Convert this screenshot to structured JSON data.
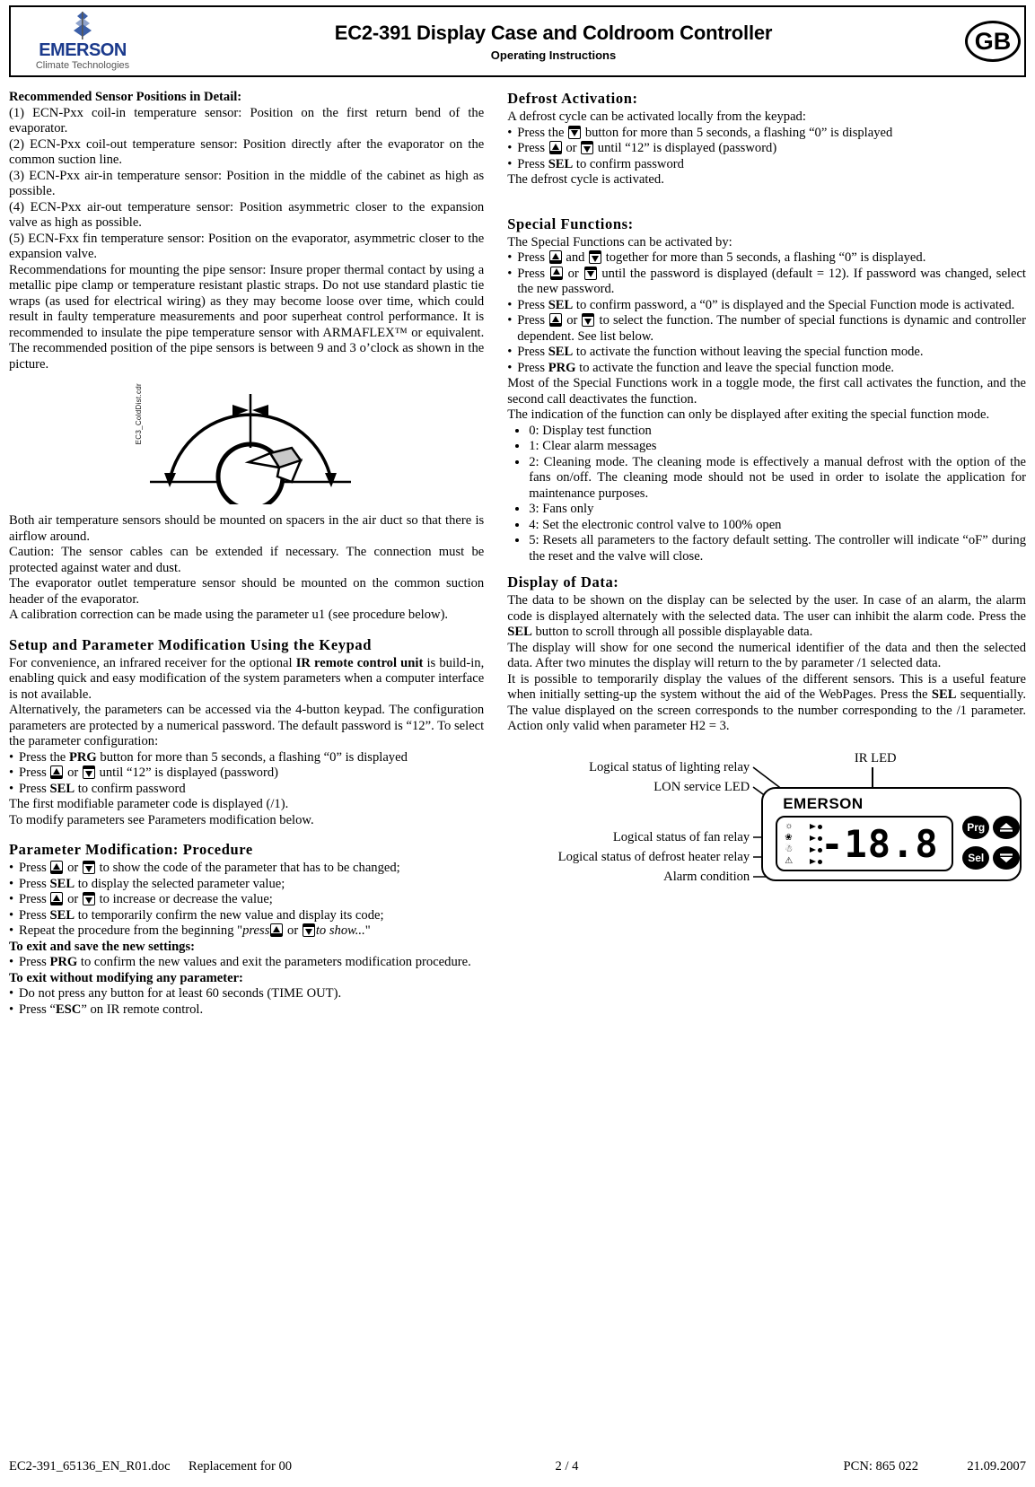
{
  "header": {
    "brand": "EMERSON",
    "brand_sub": "Climate Technologies",
    "title": "EC2-391 Display Case and Coldroom Controller",
    "subtitle": "Operating Instructions",
    "language_badge": "GB"
  },
  "left_column": {
    "sensor_heading": "Recommended Sensor Positions in Detail:",
    "sensor_items": [
      "(1) ECN-Pxx coil-in temperature sensor: Position on the first return bend of the evaporator.",
      " (2) ECN-Pxx coil-out temperature sensor: Position directly after the evaporator on the common suction line.",
      "(3) ECN-Pxx air-in temperature sensor: Position in the middle of the cabinet as high as possible.",
      "(4) ECN-Pxx air-out temperature sensor: Position asymmetric closer to the expansion valve as high as possible.",
      "(5) ECN-Fxx fin temperature sensor: Position on the evaporator, asymmetric closer to the expansion valve."
    ],
    "pipe_recommendation": "Recommendations for mounting the pipe sensor: Insure proper thermal contact by using a metallic pipe clamp or temperature resistant plastic straps. Do not use standard plastic tie wraps (as used for electrical wiring) as they may become loose over time, which could result in faulty temperature measurements and poor superheat control performance. It is recommended to insulate the pipe temperature sensor with ARMAFLEX™ or equivalent. The recommended position of the pipe sensors is between 9 and 3 o’clock as shown in the picture.",
    "figure_label": "EC3_ColdDist.cdr",
    "after_figure": [
      "Both air temperature sensors should be mounted on spacers in the air duct so that there is airflow around.",
      "Caution: The sensor cables can be extended if necessary. The connection must be protected against water and dust.",
      "The evaporator outlet temperature sensor should be mounted on the common suction header of the evaporator.",
      "A calibration correction can be made using the parameter u1 (see procedure below)."
    ],
    "setup_heading": "Setup and Parameter Modification Using the Keypad",
    "setup_p1_a": "For convenience, an infrared receiver for the optional ",
    "setup_p1_b": "IR remote control unit",
    "setup_p1_c": " is build-in, enabling quick and easy modification of the system parameters when a computer interface is not available.",
    "setup_p2": "Alternatively, the parameters can be accessed via the 4-button keypad. The configuration parameters are protected by a numerical password. The default password is “12”. To select the parameter configuration:",
    "setup_b1_a": "Press the ",
    "setup_b1_key": "PRG",
    "setup_b1_b": " button for more than 5 seconds, a flashing “0” is displayed",
    "setup_b2_a": "Press ",
    "setup_b2_mid": " or ",
    "setup_b2_b": " until “12” is displayed (password)",
    "setup_b3_a": "Press ",
    "setup_b3_key": "SEL",
    "setup_b3_b": " to confirm password",
    "setup_p3": "The first modifiable parameter code is displayed (/1).",
    "setup_p4": "To modify parameters see Parameters modification below.",
    "param_heading": "Parameter Modification: Procedure",
    "param_b1_a": "Press ",
    "param_b1_mid": " or ",
    "param_b1_b": " to show the code of the parameter that has to be changed;",
    "param_b2_a": "Press ",
    "param_b2_key": "SEL",
    "param_b2_b": " to display the selected parameter value;",
    "param_b3_a": "Press ",
    "param_b3_mid": " or ",
    "param_b3_b": " to increase or decrease the value;",
    "param_b4_a": "Press ",
    "param_b4_key": "SEL",
    "param_b4_b": " to temporarily confirm the new value and display its code;",
    "param_b5_a": "Repeat the procedure from the beginning \"",
    "param_b5_i1": "press",
    "param_b5_mid": " or ",
    "param_b5_i2": "to show...",
    "param_b5_end": "\"",
    "exit_save_heading": "To exit and save the new settings:",
    "exit_save_a": "Press ",
    "exit_save_key": "PRG",
    "exit_save_b": " to confirm the new values and exit the parameters modification procedure.",
    "exit_nomod_heading": "To exit without modifying any parameter:",
    "exit_nomod_1": "Do not press any button for at least 60 seconds (TIME OUT).",
    "exit_nomod_2_a": "Press “",
    "exit_nomod_2_key": "ESC",
    "exit_nomod_2_b": "” on IR remote control."
  },
  "right_column": {
    "defrost_heading": "Defrost Activation:",
    "defrost_p1": "A defrost cycle can be activated locally from the keypad:",
    "defrost_b1_a": "Press the ",
    "defrost_b1_b": " button for more than 5 seconds, a  flashing “0” is displayed",
    "defrost_b2_a": "Press ",
    "defrost_b2_mid": " or ",
    "defrost_b2_b": " until “12” is displayed (password)",
    "defrost_b3_a": "Press ",
    "defrost_b3_key": "SEL",
    "defrost_b3_b": " to confirm password",
    "defrost_p2": "The defrost cycle is activated.",
    "special_heading": "Special Functions:",
    "special_p1": "The Special Functions can be activated by:",
    "special_b1_a": "Press ",
    "special_b1_mid": " and ",
    "special_b1_b": " together for more than 5 seconds, a flashing “0” is displayed.",
    "special_b2_a": "Press ",
    "special_b2_mid": " or ",
    "special_b2_b": " until the password is displayed (default = 12). If password was changed, select the new password.",
    "special_b3_a": "Press ",
    "special_b3_key": "SEL",
    "special_b3_b": " to confirm password, a “0” is displayed and the Special Function mode is activated.",
    "special_b4_a": "Press ",
    "special_b4_mid": " or ",
    "special_b4_b": " to select the function. The number of special functions is dynamic and controller dependent. See list below.",
    "special_b5_a": "Press ",
    "special_b5_key": "SEL",
    "special_b5_b": " to activate the function without leaving the special function mode.",
    "special_b6_a": "Press ",
    "special_b6_key": "PRG",
    "special_b6_b": " to activate the function and leave the special function mode.",
    "special_p2": "Most of the Special Functions work in a toggle mode, the first call activates the function, and the second call deactivates the function.",
    "special_p3": "The indication of the function can only be displayed after exiting the special function mode.",
    "function_list": [
      "0: Display test function",
      "1: Clear alarm messages",
      "2: Cleaning mode. The cleaning mode is effectively a manual defrost with the option of the fans on/off. The cleaning mode should not be used in order to isolate the application for maintenance purposes.",
      "3: Fans only",
      "4: Set the electronic control valve to 100% open",
      "5: Resets all parameters to the factory default setting. The controller will indicate “oF” during the reset and the valve will close."
    ],
    "display_heading": "Display of Data:",
    "display_p1_a": "The data to be shown on the display can be selected by the user. In case of an alarm, the alarm code is displayed alternately with the selected data. The user can inhibit the alarm code. Press the ",
    "display_p1_key": "SEL",
    "display_p1_b": " button to scroll through all possible displayable data.",
    "display_p2": "The display will show for one second the numerical identifier of the data and then the selected data. After two minutes the display will return to the by parameter /1 selected data.",
    "display_p3_a": "It is possible to temporarily display the values of the different sensors. This is a useful feature when initially setting-up the system without the aid of the WebPages. Press the ",
    "display_p3_key": "SEL",
    "display_p3_b": " sequentially. The value displayed on the screen corresponds to the number corresponding to the /1 parameter. Action only valid when parameter H2 = 3."
  },
  "controller_figure": {
    "callouts": {
      "ir_led": "IR LED",
      "lighting_relay": "Logical status of lighting relay",
      "lon_service_led": "LON service LED",
      "fan_relay": "Logical status of fan relay",
      "defrost_heater_relay": "Logical status of defrost heater relay",
      "alarm_condition": "Alarm condition"
    },
    "brand": "EMERSON",
    "display_value": "-18.8",
    "buttons": {
      "prg": "Prg",
      "sel": "Sel",
      "up": "up-arrow",
      "down": "down-arrow"
    },
    "status_icons": [
      "lamp-icon",
      "fan-icon",
      "defrost-heater-icon",
      "alarm-bell-icon"
    ]
  },
  "footer": {
    "file": "EC2-391_65136_EN_R01.doc",
    "replacement": "Replacement for 00",
    "page": "2 / 4",
    "pcn": "PCN: 865 022",
    "date": "21.09.2007"
  }
}
